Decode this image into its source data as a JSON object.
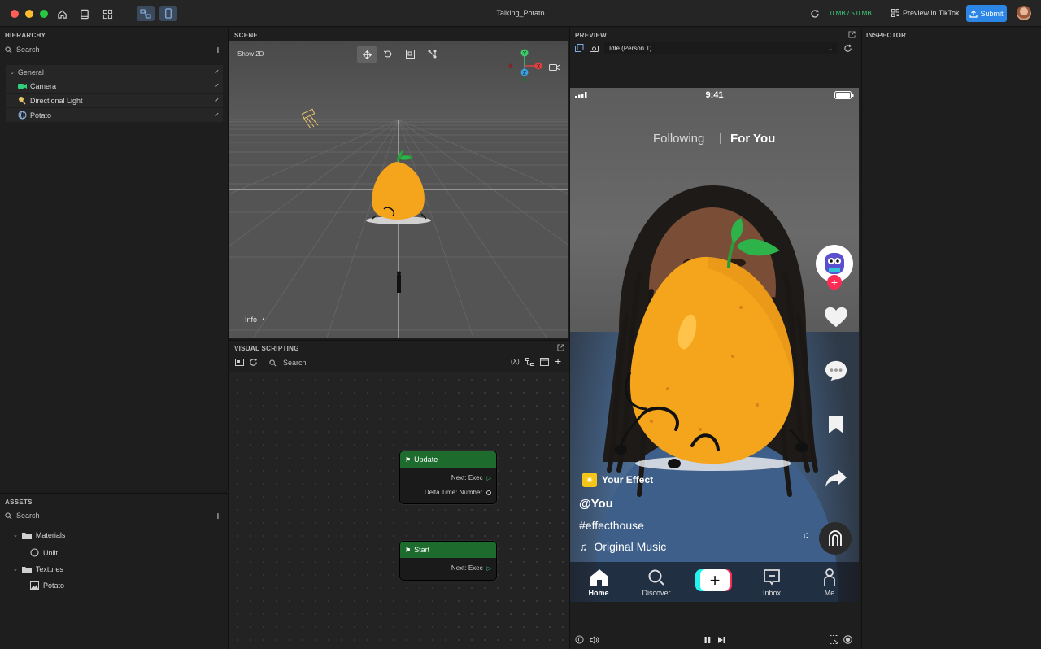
{
  "window": {
    "title": "Talking_Potato",
    "memory": "0 MB / 5.0 MB",
    "preview_in_tiktok": "Preview in TikTok",
    "submit": "Submit"
  },
  "hierarchy": {
    "title": "HIERARCHY",
    "search_placeholder": "Search",
    "group": "General",
    "items": [
      {
        "label": "Camera",
        "icon": "camera-icon",
        "color": "#2fd07b"
      },
      {
        "label": "Directional Light",
        "icon": "light-icon",
        "color": "#e9c46a"
      },
      {
        "label": "Potato",
        "icon": "globe-icon",
        "color": "#8fb8e8"
      }
    ]
  },
  "assets": {
    "title": "ASSETS",
    "search_placeholder": "Search",
    "folders": [
      {
        "label": "Materials",
        "children": [
          "Unlit"
        ]
      },
      {
        "label": "Textures",
        "children": [
          "Potato"
        ]
      }
    ]
  },
  "scene": {
    "title": "SCENE",
    "show2d": "Show 2D",
    "info": "Info",
    "gizmo": {
      "y": "Y",
      "x": "X",
      "z": "Z"
    }
  },
  "visual_scripting": {
    "title": "VISUAL SCRIPTING",
    "search_placeholder": "Search",
    "variables_label": "(X)",
    "nodes": [
      {
        "title": "Update",
        "ports": [
          "Next: Exec",
          "Delta Time: Number"
        ]
      },
      {
        "title": "Start",
        "ports": [
          "Next: Exec"
        ]
      }
    ]
  },
  "preview": {
    "title": "PREVIEW",
    "simulation": "Idle (Person 1)",
    "phone": {
      "time": "9:41",
      "following": "Following",
      "for_you": "For You",
      "effect": "Your Effect",
      "user": "@You",
      "hashtag": "#effecthouse",
      "music": "Original Music",
      "tabs": [
        "Home",
        "Discover",
        "",
        "Inbox",
        "Me"
      ]
    }
  },
  "inspector": {
    "title": "INSPECTOR"
  },
  "colors": {
    "accent": "#2b86e6",
    "memory": "#3fd07a",
    "node_header": "#1e6b2e",
    "potato": "#f5a51c"
  }
}
